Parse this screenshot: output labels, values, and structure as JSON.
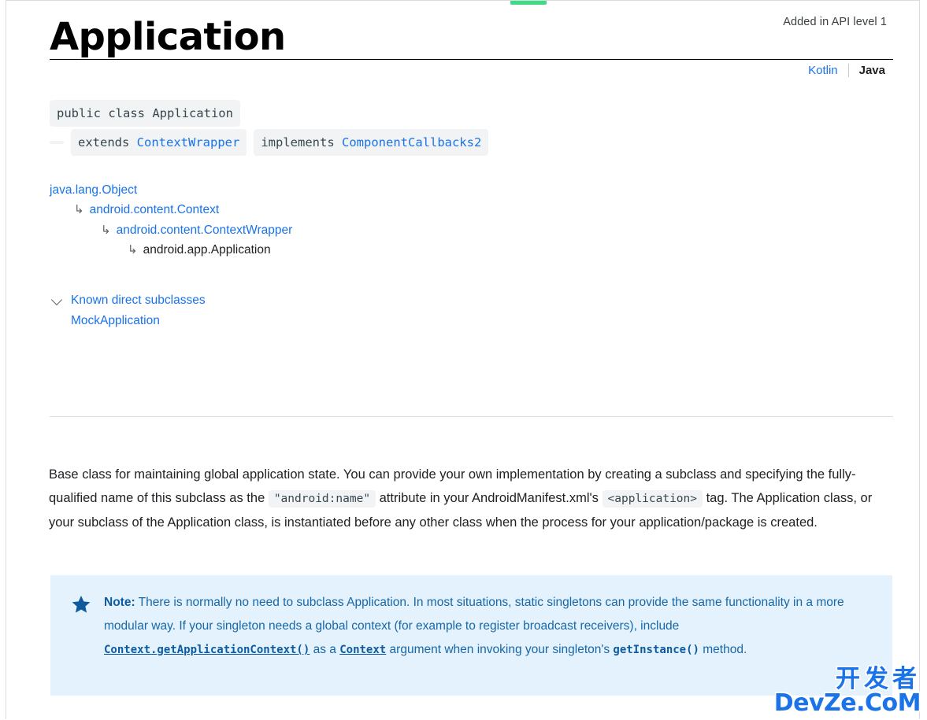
{
  "header": {
    "api_level": "Added in API level 1",
    "title": "Application"
  },
  "language_switcher": {
    "kotlin": "Kotlin",
    "java": "Java",
    "active": "Java"
  },
  "signature": {
    "line1": "public class Application",
    "extends_keyword": "extends",
    "extends_type": "ContextWrapper",
    "implements_keyword": "implements",
    "implements_type": "ComponentCallbacks2"
  },
  "inheritance": {
    "arrow": "↳",
    "levels": [
      {
        "label": "java.lang.Object",
        "link": true
      },
      {
        "label": "android.content.Context",
        "link": true
      },
      {
        "label": "android.content.ContextWrapper",
        "link": true
      },
      {
        "label": "android.app.Application",
        "link": false
      }
    ]
  },
  "subclasses": {
    "heading": "Known direct subclasses",
    "chevron_icon": "chevron-down-icon",
    "items": [
      "MockApplication"
    ]
  },
  "description": {
    "part1": "Base class for maintaining global application state. You can provide your own implementation by creating a subclass and specifying the fully-qualified name of this subclass as the ",
    "code1": "\"android:name\"",
    "part2": " attribute in your AndroidManifest.xml's ",
    "code2": "<application>",
    "part3": " tag. The Application class, or your subclass of the Application class, is instantiated before any other class when the process for your application/package is created."
  },
  "note": {
    "icon": "star-icon",
    "label": "Note:",
    "text1": " There is normally no need to subclass Application. In most situations, static singletons can provide the same functionality in a more modular way. If your singleton needs a global context (for example to register broadcast receivers), include ",
    "link1": "Context.getApplicationContext()",
    "text2": " as a ",
    "link2": "Context",
    "text3": " argument when invoking your singleton's ",
    "code1": "getInstance()",
    "text4": " method.",
    "background_color": "#e3f2fd",
    "text_color": "#1967a6"
  },
  "watermark": {
    "line_cn": "开发者",
    "line_en": "DevZe.CoM",
    "color": "#1a73e8"
  },
  "theme": {
    "link_color": "#1a73e8",
    "progress_color": "#3ddc84",
    "chip_background": "#f1f3f4"
  }
}
